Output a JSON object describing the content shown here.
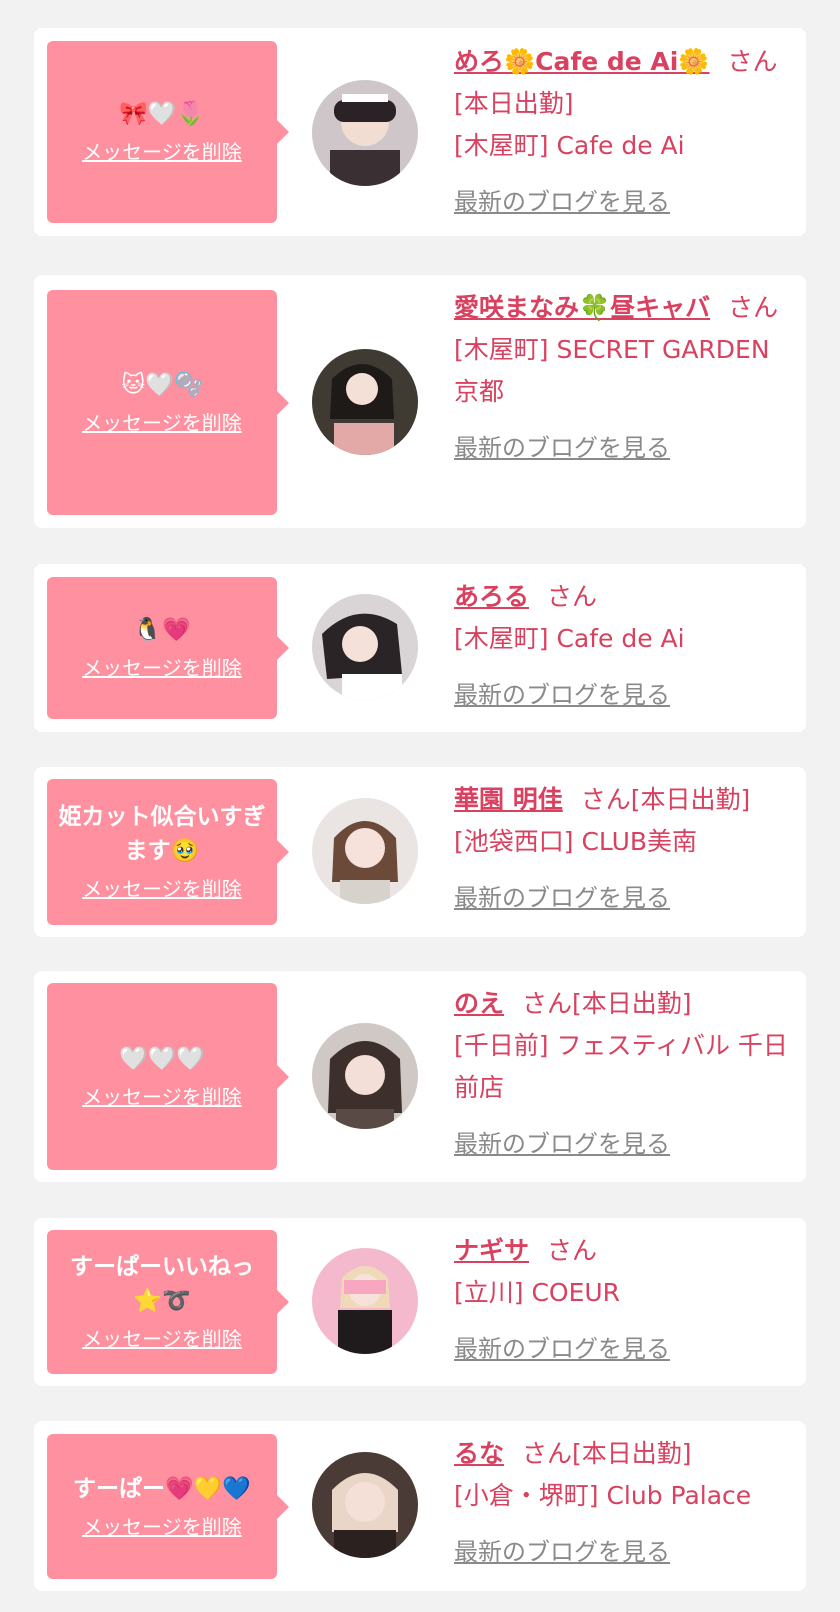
{
  "delete_label": "メッセージを削除",
  "suffix_san": "さん",
  "blog_label": "最新のブログを見る",
  "colors": {
    "bubble": "#ff909f",
    "accent": "#d8415f",
    "link_gray": "#8a8a8a",
    "background": "#f2f2f2"
  },
  "entries": [
    {
      "message": "🎀🤍🌷",
      "name": "めろ🌼Cafe de Ai🌼",
      "status": "[本日出勤]",
      "shop": "[木屋町] Cafe de Ai"
    },
    {
      "message": "🐱🤍🫧",
      "name": "愛咲まなみ🍀昼キャバ",
      "status": "",
      "shop": "[木屋町] SECRET GARDEN 京都"
    },
    {
      "message": "🐧💗",
      "name": "あろる",
      "status": "",
      "shop": "[木屋町] Cafe de Ai"
    },
    {
      "message": "姫カット似合いすぎます🥹",
      "name": "華園 明佳",
      "status": "[本日出勤]",
      "shop": "[池袋西口] CLUB美南"
    },
    {
      "message": "🤍🤍🤍",
      "name": "のえ",
      "status": "[本日出勤]",
      "shop": "[千日前] フェスティバル 千日前店"
    },
    {
      "message": "すーぱーいいねっ⭐️➰",
      "name": "ナギサ",
      "status": "",
      "shop": "[立川] COEUR"
    },
    {
      "message": "すーぱー💗💛💙",
      "name": "るな",
      "status": "[本日出勤]",
      "shop": "[小倉・堺町] Club Palace"
    }
  ]
}
